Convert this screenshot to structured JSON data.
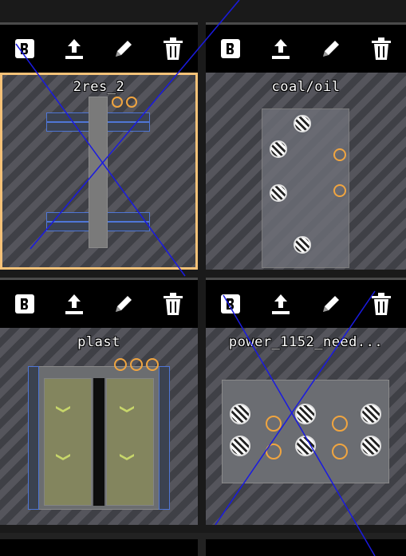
{
  "blueprints": [
    {
      "title": "2res_2",
      "selected": true
    },
    {
      "title": "coal/oil",
      "selected": false
    },
    {
      "title": "plast",
      "selected": false
    },
    {
      "title": "power_1152_need...",
      "selected": false
    }
  ],
  "toolbar": {
    "icons": [
      "blueprint-book-icon",
      "upload-icon",
      "pencil-icon",
      "trash-icon"
    ]
  },
  "colors": {
    "selection": "#f6c278",
    "annotation_line": "#1a1ae0"
  }
}
